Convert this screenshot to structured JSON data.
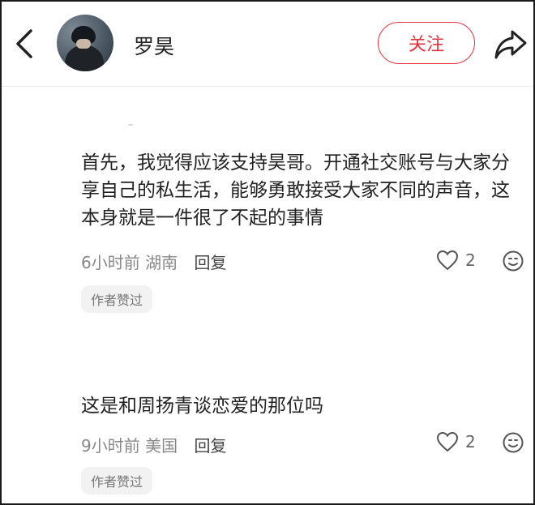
{
  "header": {
    "username": "罗昊",
    "follow_label": "关注"
  },
  "comments": [
    {
      "text": "首先，我觉得应该支持昊哥。开通社交账号与大家分享自己的私生活，能够勇敢接受大家不同的声音，这本身就是一件很了不起的事情",
      "time": "6小时前",
      "location": "湖南",
      "reply_label": "回复",
      "likes": "2",
      "badge": "作者赞过"
    },
    {
      "text": "这是和周扬青谈恋爱的那位吗",
      "time": "9小时前",
      "location": "美国",
      "reply_label": "回复",
      "likes": "2",
      "badge": "作者赞过"
    }
  ],
  "icons": {
    "back": "chevron-left-icon",
    "share": "share-arrow-icon",
    "like": "heart-outline-icon",
    "emoji": "smiley-icon"
  },
  "colors": {
    "accent": "#e0343f",
    "muted": "#888888",
    "badge_bg": "#f2f2f2"
  }
}
